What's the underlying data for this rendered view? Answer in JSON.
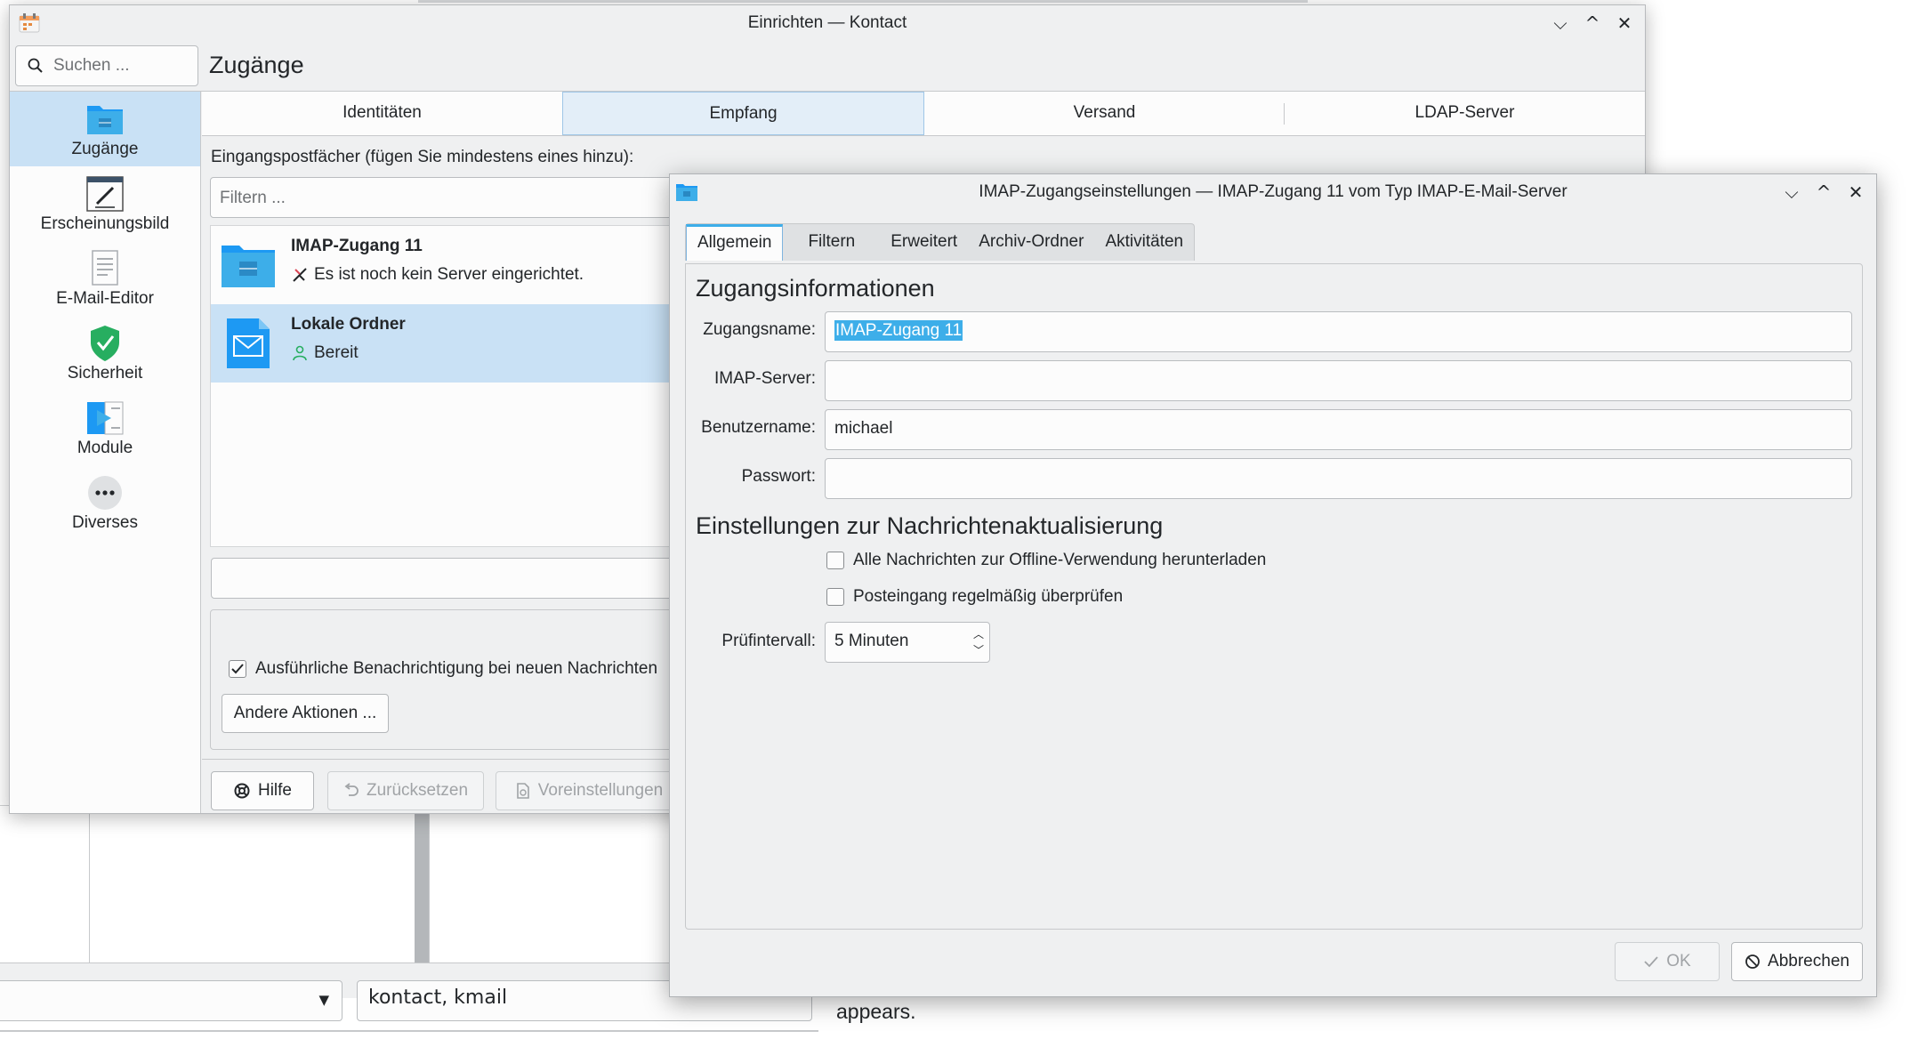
{
  "background": {
    "field_text": "kontact, kmail",
    "trailing_text": "appears."
  },
  "main_window": {
    "title": "Einrichten — Kontact",
    "search_placeholder": "Suchen ...",
    "page_title": "Zugänge",
    "sidebar": [
      {
        "label": "Zugänge",
        "icon": "folder-icon",
        "active": true
      },
      {
        "label": "Erscheinungsbild",
        "icon": "appearance-icon",
        "active": false
      },
      {
        "label": "E-Mail-Editor",
        "icon": "document-icon",
        "active": false
      },
      {
        "label": "Sicherheit",
        "icon": "shield-icon",
        "active": false
      },
      {
        "label": "Module",
        "icon": "plugin-icon",
        "active": false
      },
      {
        "label": "Diverses",
        "icon": "more-icon",
        "active": false
      }
    ],
    "tabs": [
      {
        "label": "Identitäten",
        "active": false
      },
      {
        "label": "Empfang",
        "active": true
      },
      {
        "label": "Versand",
        "active": false
      },
      {
        "label": "LDAP-Server",
        "active": false
      }
    ],
    "inbox_label": "Eingangspostfächer (fügen Sie mindestens eines hinzu):",
    "filter_placeholder": "Filtern ...",
    "accounts": [
      {
        "name": "IMAP-Zugang 11",
        "status": "Es ist noch kein Server eingerichtet.",
        "status_icon": "disconnected-icon"
      },
      {
        "name": "Lokale Ordner",
        "status": "Bereit",
        "status_icon": "online-user-icon"
      }
    ],
    "notify_checkbox": {
      "label": "Ausführliche Benachrichtigung bei neuen Nachrichten",
      "checked": true
    },
    "other_actions_button": "Andere Aktionen ...",
    "help_button": "Hilfe",
    "reset_button": "Zurücksetzen",
    "defaults_button": "Voreinstellungen"
  },
  "dialog": {
    "title": "IMAP-Zugangseinstellungen — IMAP-Zugang 11 vom Typ IMAP-E-Mail-Server",
    "tabs": [
      {
        "label": "Allgemein",
        "active": true
      },
      {
        "label": "Filtern",
        "active": false
      },
      {
        "label": "Erweitert",
        "active": false
      },
      {
        "label": "Archiv-Ordner",
        "active": false
      },
      {
        "label": "Aktivitäten",
        "active": false
      }
    ],
    "section_account": "Zugangsinformationen",
    "fields": {
      "account_name": {
        "label": "Zugangsname:",
        "value": "IMAP-Zugang 11"
      },
      "imap_server": {
        "label": "IMAP-Server:",
        "value": ""
      },
      "username": {
        "label": "Benutzername:",
        "value": "michael"
      },
      "password": {
        "label": "Passwort:",
        "value": ""
      }
    },
    "section_update": "Einstellungen zur Nachrichtenaktualisierung",
    "offline_checkbox": {
      "label": "Alle Nachrichten zur Offline-Verwendung herunterladen",
      "checked": false
    },
    "check_inbox_checkbox": {
      "label": "Posteingang regelmäßig überprüfen",
      "checked": false
    },
    "interval": {
      "label": "Prüfintervall:",
      "value": "5 Minuten"
    },
    "ok_button": "OK",
    "cancel_button": "Abbrechen"
  },
  "colors": {
    "accent": "#3daee9",
    "selection_bg": "#c9e1f5",
    "window_bg": "#eff0f1",
    "field_bg": "#fcfcfc",
    "text": "#232629",
    "disabled_text": "#a0a3a6"
  }
}
